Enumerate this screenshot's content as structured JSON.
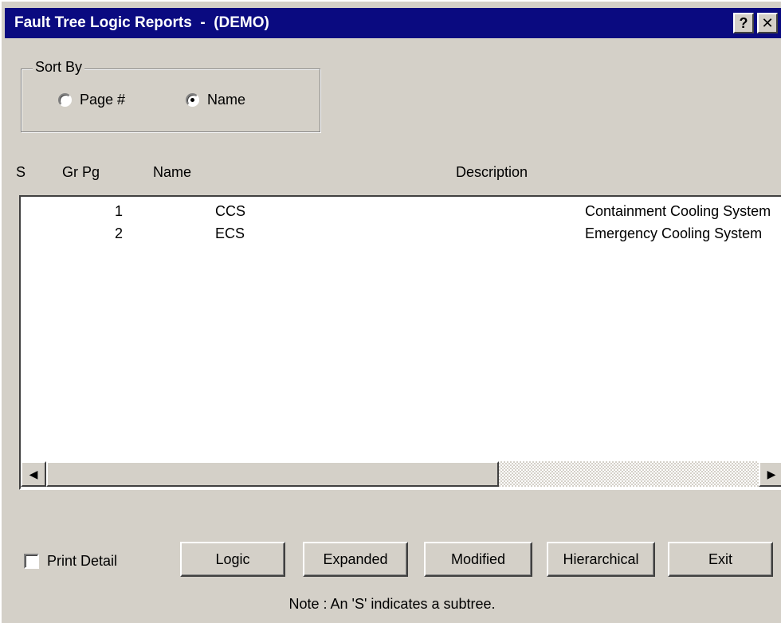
{
  "window": {
    "title": "Fault Tree Logic Reports  -  (DEMO)",
    "help_button": "?",
    "close_button": "✕"
  },
  "sort_by": {
    "label": "Sort By",
    "options": [
      {
        "label": "Page #",
        "selected": false
      },
      {
        "label": "Name",
        "selected": true
      }
    ]
  },
  "columns": {
    "s": "S",
    "gr_pg": "Gr Pg",
    "name": "Name",
    "description": "Description"
  },
  "rows": [
    {
      "s": "",
      "gr_pg": "1",
      "name": "CCS",
      "description": "Containment Cooling System"
    },
    {
      "s": "",
      "gr_pg": "2",
      "name": "ECS",
      "description": "Emergency Cooling System"
    }
  ],
  "scrollbar": {
    "left_arrow_icon": "arrow-left-icon",
    "right_arrow_icon": "arrow-right-icon"
  },
  "print_detail": {
    "label": "Print Detail",
    "checked": false
  },
  "buttons": [
    {
      "id": "logic",
      "label": "Logic"
    },
    {
      "id": "expanded",
      "label": "Expanded"
    },
    {
      "id": "modified",
      "label": "Modified"
    },
    {
      "id": "hierarchical",
      "label": "Hierarchical"
    },
    {
      "id": "exit",
      "label": "Exit"
    }
  ],
  "note": "Note :  An 'S' indicates a subtree.",
  "colors": {
    "titlebar": "#0a0a80",
    "face": "#d4d0c8",
    "list_background": "#ffffff"
  }
}
